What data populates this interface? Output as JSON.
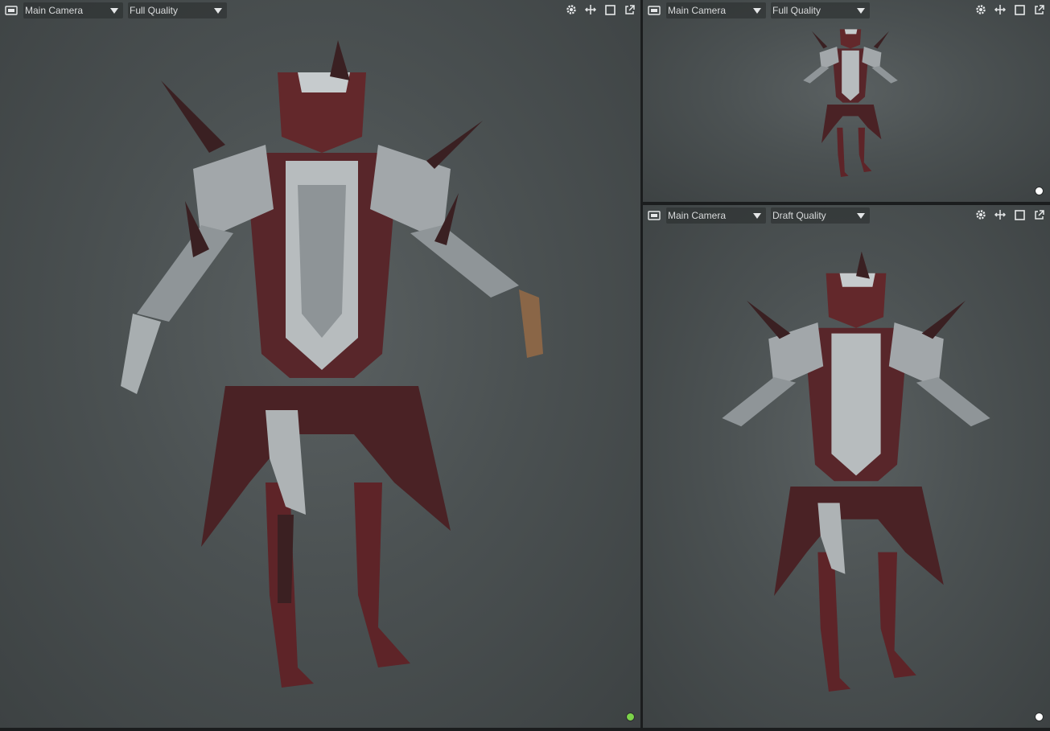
{
  "colors": {
    "status_active": "#7cd34a",
    "status_idle": "#ffffff",
    "viewport_bg": "#4b5152",
    "armor_metal": "#9ea3a6",
    "armor_red": "#5e2428"
  },
  "icons": {
    "camera": "camera-icon",
    "settings": "gear-icon",
    "move": "move-arrows-icon",
    "maximize": "maximize-square-icon",
    "popout": "popout-icon"
  },
  "viewports": {
    "main": {
      "camera": "Main Camera",
      "quality": "Full Quality",
      "status": "active"
    },
    "top_right": {
      "camera": "Main Camera",
      "quality": "Full Quality",
      "status": "idle"
    },
    "bottom_right": {
      "camera": "Main Camera",
      "quality": "Draft Quality",
      "status": "idle"
    }
  }
}
